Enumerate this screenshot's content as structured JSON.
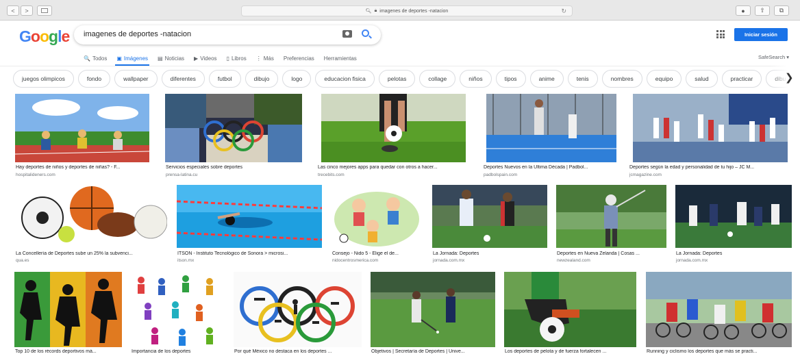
{
  "browser": {
    "address": "imagenes de deportes -natacion",
    "back_icon": "chevron-left-icon",
    "forward_icon": "chevron-right-icon"
  },
  "google": {
    "logo_letters": [
      "G",
      "o",
      "o",
      "g",
      "l",
      "e"
    ],
    "query": "imagenes de deportes -natacion",
    "signin_label": "Iniciar sesión",
    "safesearch_label": "SafeSearch ▾"
  },
  "tabs": [
    {
      "label": "Todos",
      "icon": "🔍"
    },
    {
      "label": "Imágenes",
      "icon": "▣"
    },
    {
      "label": "Noticias",
      "icon": "▤"
    },
    {
      "label": "Videos",
      "icon": "▶"
    },
    {
      "label": "Libros",
      "icon": "▯"
    },
    {
      "label": "Más",
      "icon": "⋮"
    },
    {
      "label": "Preferencias",
      "icon": ""
    },
    {
      "label": "Herramientas",
      "icon": ""
    }
  ],
  "chips": [
    "juegos olimpicos",
    "fondo",
    "wallpaper",
    "diferentes",
    "futbol",
    "dibujo",
    "logo",
    "educacion fisica",
    "pelotas",
    "collage",
    "niños",
    "tipos",
    "anime",
    "tenis",
    "nombres",
    "equipo",
    "salud",
    "practicar",
    "dibu"
  ],
  "results": [
    {
      "caption": "Hay deportes de niños y deportes de niñas? - F...",
      "source": "hospitalideners.com",
      "scene": "kids-start"
    },
    {
      "caption": "Servicios especiales sobre deportes",
      "source": "prensa-latina.cu",
      "scene": "olympic-collage"
    },
    {
      "caption": "Las cinco mejores apps para quedar con otros a hacer...",
      "source": "trecebits.com",
      "scene": "soccer-kick"
    },
    {
      "caption": "Deportes Nuevos en la Última Década | Padbol...",
      "source": "padbolspain.com",
      "scene": "padbol"
    },
    {
      "caption": "Deportes según la edad y personalidad de tu hijo – JC M...",
      "source": "jcmagazine.com",
      "scene": "volleyball"
    },
    {
      "caption": "La Concellería de Deportes sube un 25% la subvenci...",
      "source": "qua.es",
      "scene": "balls"
    },
    {
      "caption": "ITSON - Instituto Tecnológico de Sonora > microsi...",
      "source": "itson.mx",
      "scene": "swimmer"
    },
    {
      "caption": "Consejo - Nido 5 - Elige el de...",
      "source": "nidocentrosmerica.com",
      "scene": "cartoon-kids"
    },
    {
      "caption": "La Jornada: Deportes",
      "source": "jornada.com.mx",
      "scene": "soccer-players"
    },
    {
      "caption": "Deportes en Nueva Zelanda | Cosas ...",
      "source": "newzealand.com",
      "scene": "golfer"
    },
    {
      "caption": "La Jornada: Deportes",
      "source": "jornada.com.mx",
      "scene": "soccer-night"
    },
    {
      "caption": "Top 10 de los récords deportivos má...",
      "source": "",
      "scene": "silhouettes"
    },
    {
      "caption": "Importancia de los deportes",
      "source": "",
      "scene": "pictograms"
    },
    {
      "caption": "Por qué México no destaca en los deportes ...",
      "source": "",
      "scene": "olympic-rings"
    },
    {
      "caption": "Objetivos | Secretaría de Deportes | Unive...",
      "source": "",
      "scene": "hockey"
    },
    {
      "caption": "Los deportes de pelota y de fuerza fortalecen ...",
      "source": "",
      "scene": "soccer-ball-close"
    },
    {
      "caption": "Running y ciclismo los deportes que más se practi...",
      "source": "",
      "scene": "cyclists"
    }
  ]
}
